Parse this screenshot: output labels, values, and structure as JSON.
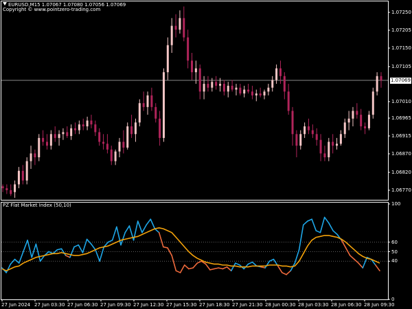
{
  "header": {
    "symbol_line": "EURUSD,M15  1.07067 1.07080 1.07056 1.07069",
    "copyright": "Copyright © www.pointzero-trading.com"
  },
  "indicator": {
    "title": "PZ Flat Market Index (50,10)"
  },
  "current_price": "1.07069",
  "colors": {
    "background": "#000000",
    "bull_candle": "#F5C6C6",
    "bear_candle": "#B0245A",
    "index_line": "#1EA7E8",
    "index_flat": "#F06A3C",
    "signal_line": "#F5A30A",
    "price_line": "#8A8A8A",
    "level_line": "#606060"
  },
  "price_axis": [
    "1.07250",
    "1.07205",
    "1.07150",
    "1.07105",
    "1.07069",
    "1.07010",
    "1.06965",
    "1.06915",
    "1.06870",
    "1.06820",
    "1.06770"
  ],
  "indicator_axis": [
    "100",
    "60",
    "50",
    "40",
    "0"
  ],
  "time_axis": [
    "27 Jun 2024",
    "27 Jun 03:30",
    "27 Jun 06:30",
    "27 Jun 09:30",
    "27 Jun 12:30",
    "27 Jun 15:30",
    "27 Jun 18:30",
    "27 Jun 21:30",
    "28 Jun 00:30",
    "28 Jun 03:30",
    "28 Jun 06:30",
    "28 Jun 09:30"
  ],
  "chart_data": {
    "type": "candlestick",
    "price_range": [
      1.0676,
      1.07275
    ],
    "indicator_range": [
      0,
      100
    ],
    "levels": [
      60,
      50,
      40
    ],
    "current_price": 1.07069,
    "ohlc": [
      [
        1.06795,
        1.068,
        1.0678,
        1.0679
      ],
      [
        1.0679,
        1.068,
        1.06775,
        1.06785
      ],
      [
        1.06785,
        1.068,
        1.0677,
        1.06775
      ],
      [
        1.0678,
        1.0681,
        1.06765,
        1.068
      ],
      [
        1.068,
        1.06845,
        1.0679,
        1.06835
      ],
      [
        1.06835,
        1.0685,
        1.068,
        1.0681
      ],
      [
        1.0681,
        1.0687,
        1.068,
        1.0686
      ],
      [
        1.0686,
        1.069,
        1.0684,
        1.0688
      ],
      [
        1.0688,
        1.0689,
        1.0685,
        1.0687
      ],
      [
        1.0687,
        1.0693,
        1.0686,
        1.0692
      ],
      [
        1.0692,
        1.0694,
        1.069,
        1.0691
      ],
      [
        1.0691,
        1.0693,
        1.0689,
        1.069
      ],
      [
        1.069,
        1.0694,
        1.0689,
        1.0693
      ],
      [
        1.0693,
        1.0695,
        1.0691,
        1.0692
      ],
      [
        1.0692,
        1.0694,
        1.069,
        1.0693
      ],
      [
        1.0693,
        1.06945,
        1.06915,
        1.06935
      ],
      [
        1.06935,
        1.0695,
        1.0692,
        1.06925
      ],
      [
        1.06925,
        1.06955,
        1.06915,
        1.06945
      ],
      [
        1.06945,
        1.0696,
        1.0693,
        1.0694
      ],
      [
        1.0694,
        1.06965,
        1.0693,
        1.06955
      ],
      [
        1.06955,
        1.0697,
        1.0694,
        1.0695
      ],
      [
        1.0695,
        1.06975,
        1.0694,
        1.06965
      ],
      [
        1.06965,
        1.0698,
        1.06945,
        1.06955
      ],
      [
        1.06955,
        1.06965,
        1.06925,
        1.06935
      ],
      [
        1.06935,
        1.06945,
        1.069,
        1.0691
      ],
      [
        1.0691,
        1.0693,
        1.0689,
        1.06905
      ],
      [
        1.06905,
        1.0693,
        1.0688,
        1.0689
      ],
      [
        1.0689,
        1.069,
        1.0685,
        1.0686
      ],
      [
        1.0686,
        1.0689,
        1.0685,
        1.06885
      ],
      [
        1.06885,
        1.0692,
        1.0687,
        1.0691
      ],
      [
        1.0691,
        1.0694,
        1.0688,
        1.06895
      ],
      [
        1.06895,
        1.0696,
        1.0689,
        1.0695
      ],
      [
        1.0695,
        1.0698,
        1.0692,
        1.0693
      ],
      [
        1.0693,
        1.0697,
        1.0691,
        1.0696
      ],
      [
        1.0696,
        1.0702,
        1.0695,
        1.0701
      ],
      [
        1.0701,
        1.0704,
        1.0699,
        1.07
      ],
      [
        1.07,
        1.0704,
        1.0698,
        1.0703
      ],
      [
        1.0703,
        1.0705,
        1.0699,
        1.07
      ],
      [
        1.07,
        1.0701,
        1.0696,
        1.0697
      ],
      [
        1.0697,
        1.0699,
        1.069,
        1.0692
      ],
      [
        1.0692,
        1.071,
        1.0691,
        1.0709
      ],
      [
        1.0709,
        1.0718,
        1.0707,
        1.0716
      ],
      [
        1.0716,
        1.0723,
        1.0714,
        1.0721
      ],
      [
        1.0721,
        1.0724,
        1.0718,
        1.072
      ],
      [
        1.072,
        1.0725,
        1.0719,
        1.0723
      ],
      [
        1.0723,
        1.0726,
        1.0717,
        1.0718
      ],
      [
        1.0718,
        1.072,
        1.071,
        1.0712
      ],
      [
        1.0712,
        1.0714,
        1.0707,
        1.0709
      ],
      [
        1.0709,
        1.0712,
        1.0706,
        1.071
      ],
      [
        1.071,
        1.0711,
        1.0702,
        1.0704
      ],
      [
        1.0704,
        1.0708,
        1.0702,
        1.0706
      ],
      [
        1.0706,
        1.0708,
        1.0704,
        1.0705
      ],
      [
        1.0705,
        1.07075,
        1.0704,
        1.07065
      ],
      [
        1.07065,
        1.0708,
        1.07045,
        1.07055
      ],
      [
        1.07055,
        1.07075,
        1.0704,
        1.0706
      ],
      [
        1.0706,
        1.0707,
        1.0703,
        1.0704
      ],
      [
        1.0704,
        1.07065,
        1.07025,
        1.07055
      ],
      [
        1.07055,
        1.0707,
        1.0704,
        1.07045
      ],
      [
        1.07045,
        1.0706,
        1.0703,
        1.0705
      ],
      [
        1.0705,
        1.0706,
        1.0703,
        1.07035
      ],
      [
        1.07035,
        1.07055,
        1.07025,
        1.07045
      ],
      [
        1.07045,
        1.0706,
        1.07035,
        1.0704
      ],
      [
        1.0704,
        1.07055,
        1.0702,
        1.0703
      ],
      [
        1.0703,
        1.07045,
        1.07015,
        1.07035
      ],
      [
        1.07035,
        1.0705,
        1.07025,
        1.0703
      ],
      [
        1.0703,
        1.07045,
        1.0702,
        1.0704
      ],
      [
        1.0704,
        1.0706,
        1.0703,
        1.0705
      ],
      [
        1.0705,
        1.0708,
        1.0704,
        1.0707
      ],
      [
        1.0707,
        1.0711,
        1.0706,
        1.071
      ],
      [
        1.071,
        1.0712,
        1.0706,
        1.0708
      ],
      [
        1.0708,
        1.0709,
        1.0702,
        1.0704
      ],
      [
        1.0704,
        1.0706,
        1.0698,
        1.0699
      ],
      [
        1.0699,
        1.07,
        1.069,
        1.0693
      ],
      [
        1.0693,
        1.0694,
        1.0687,
        1.069
      ],
      [
        1.069,
        1.0694,
        1.0689,
        1.0693
      ],
      [
        1.0693,
        1.0696,
        1.0692,
        1.0695
      ],
      [
        1.0695,
        1.0697,
        1.0693,
        1.0694
      ],
      [
        1.0694,
        1.06955,
        1.0692,
        1.0693
      ],
      [
        1.0693,
        1.06945,
        1.069,
        1.06915
      ],
      [
        1.06915,
        1.0693,
        1.0686,
        1.0688
      ],
      [
        1.0688,
        1.069,
        1.0686,
        1.0687
      ],
      [
        1.0687,
        1.0692,
        1.0686,
        1.0691
      ],
      [
        1.0691,
        1.0693,
        1.0688,
        1.069
      ],
      [
        1.069,
        1.0692,
        1.0689,
        1.06905
      ],
      [
        1.06905,
        1.0694,
        1.069,
        1.0693
      ],
      [
        1.0693,
        1.0697,
        1.0692,
        1.0696
      ],
      [
        1.0696,
        1.0699,
        1.0694,
        1.0697
      ],
      [
        1.0697,
        1.07,
        1.0695,
        1.0699
      ],
      [
        1.0699,
        1.0701,
        1.0697,
        1.0698
      ],
      [
        1.0698,
        1.06995,
        1.0694,
        1.0695
      ],
      [
        1.0695,
        1.0696,
        1.0693,
        1.06945
      ],
      [
        1.06945,
        1.0699,
        1.0694,
        1.0698
      ],
      [
        1.0698,
        1.0705,
        1.0697,
        1.0704
      ],
      [
        1.0704,
        1.0709,
        1.0703,
        1.0708
      ],
      [
        1.0708,
        1.0709,
        1.0705,
        1.07069
      ]
    ],
    "index": [
      33,
      28,
      37,
      42,
      38,
      50,
      62,
      44,
      58,
      40,
      46,
      50,
      48,
      52,
      53,
      46,
      44,
      55,
      57,
      49,
      63,
      58,
      52,
      40,
      55,
      60,
      62,
      76,
      57,
      70,
      77,
      62,
      82,
      70,
      78,
      84,
      74,
      70,
      55,
      54,
      46,
      30,
      28,
      36,
      32,
      33,
      38,
      40,
      37,
      31,
      32,
      33,
      32,
      34,
      30,
      38,
      36,
      32,
      37,
      39,
      35,
      34,
      33,
      40,
      42,
      35,
      28,
      26,
      30,
      38,
      52,
      78,
      82,
      84,
      72,
      70,
      86,
      80,
      72,
      68,
      62,
      54,
      46,
      42,
      38,
      33,
      44,
      42,
      36,
      30
    ],
    "signal": [
      32,
      30,
      32,
      34,
      35,
      38,
      40,
      42,
      44,
      45,
      46,
      47,
      48,
      48,
      49,
      48,
      47,
      46,
      46,
      47,
      48,
      50,
      52,
      54,
      55,
      56,
      58,
      60,
      62,
      63,
      64,
      65,
      66,
      68,
      70,
      72,
      74,
      75,
      74,
      72,
      70,
      65,
      60,
      55,
      50,
      46,
      43,
      41,
      39,
      38,
      37,
      37,
      36,
      36,
      35,
      35,
      34,
      34,
      34,
      35,
      35,
      35,
      35,
      36,
      36,
      36,
      35,
      35,
      34,
      35,
      40,
      48,
      56,
      62,
      65,
      66,
      67,
      67,
      66,
      65,
      63,
      60,
      56,
      52,
      48,
      45,
      43,
      42,
      40,
      38
    ]
  }
}
